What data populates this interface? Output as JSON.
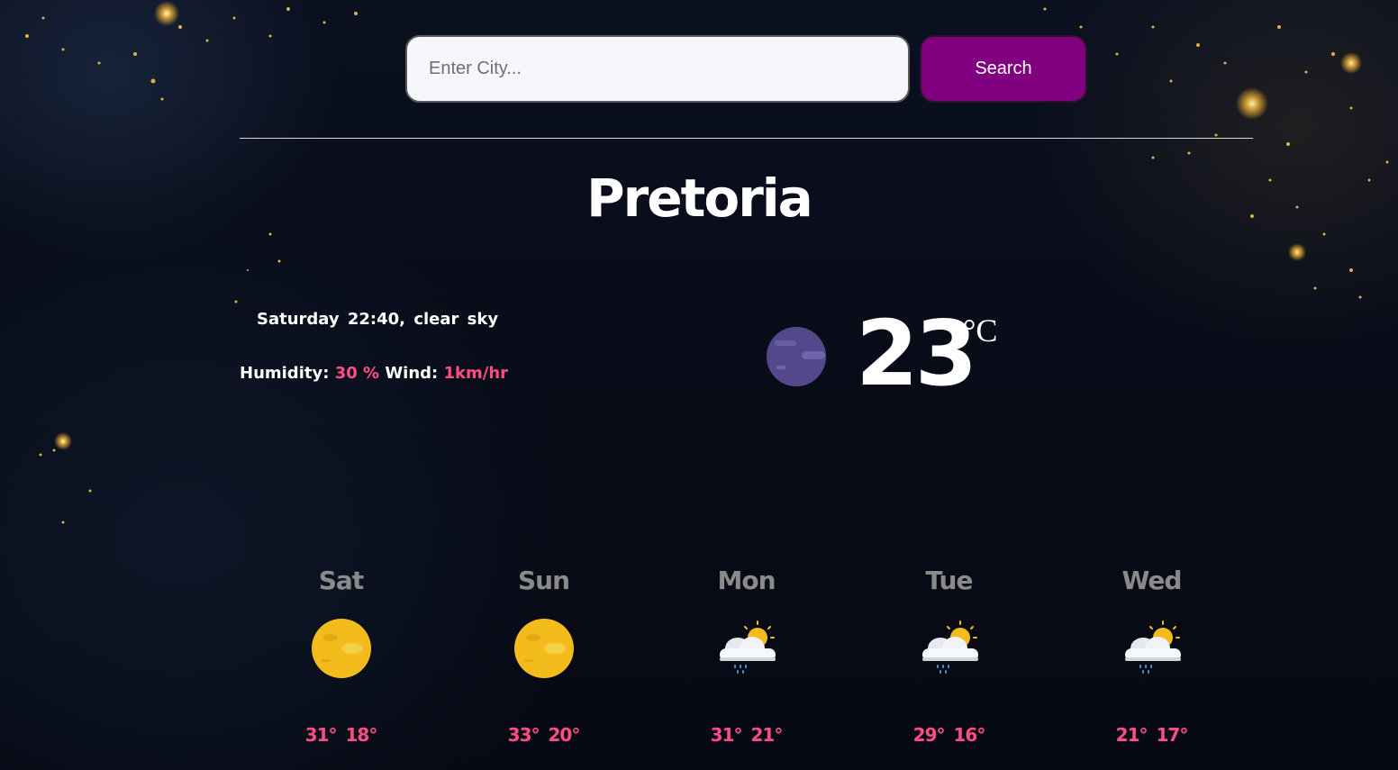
{
  "search": {
    "placeholder": "Enter City...",
    "button_label": "Search"
  },
  "current": {
    "city": "Pretoria",
    "day_time": "Saturday 22:40,",
    "description": "clear sky",
    "humidity_label": "Humidity:",
    "humidity_value": "30 %",
    "wind_label": "Wind:",
    "wind_value": "1km/hr",
    "temperature": "23",
    "unit": "°C",
    "icon": "moon-icon"
  },
  "forecast": [
    {
      "day": "Sat",
      "high": "31°",
      "low": "18°",
      "icon": "sun-icon"
    },
    {
      "day": "Sun",
      "high": "33°",
      "low": "20°",
      "icon": "sun-icon"
    },
    {
      "day": "Mon",
      "high": "31°",
      "low": "21°",
      "icon": "rain-cloud-sun-icon"
    },
    {
      "day": "Tue",
      "high": "29°",
      "low": "16°",
      "icon": "rain-cloud-sun-icon"
    },
    {
      "day": "Wed",
      "high": "21°",
      "low": "17°",
      "icon": "rain-cloud-sun-icon"
    }
  ],
  "colors": {
    "accent": "#ff4d84",
    "button": "#800080",
    "day_label": "#8a8a8a"
  }
}
